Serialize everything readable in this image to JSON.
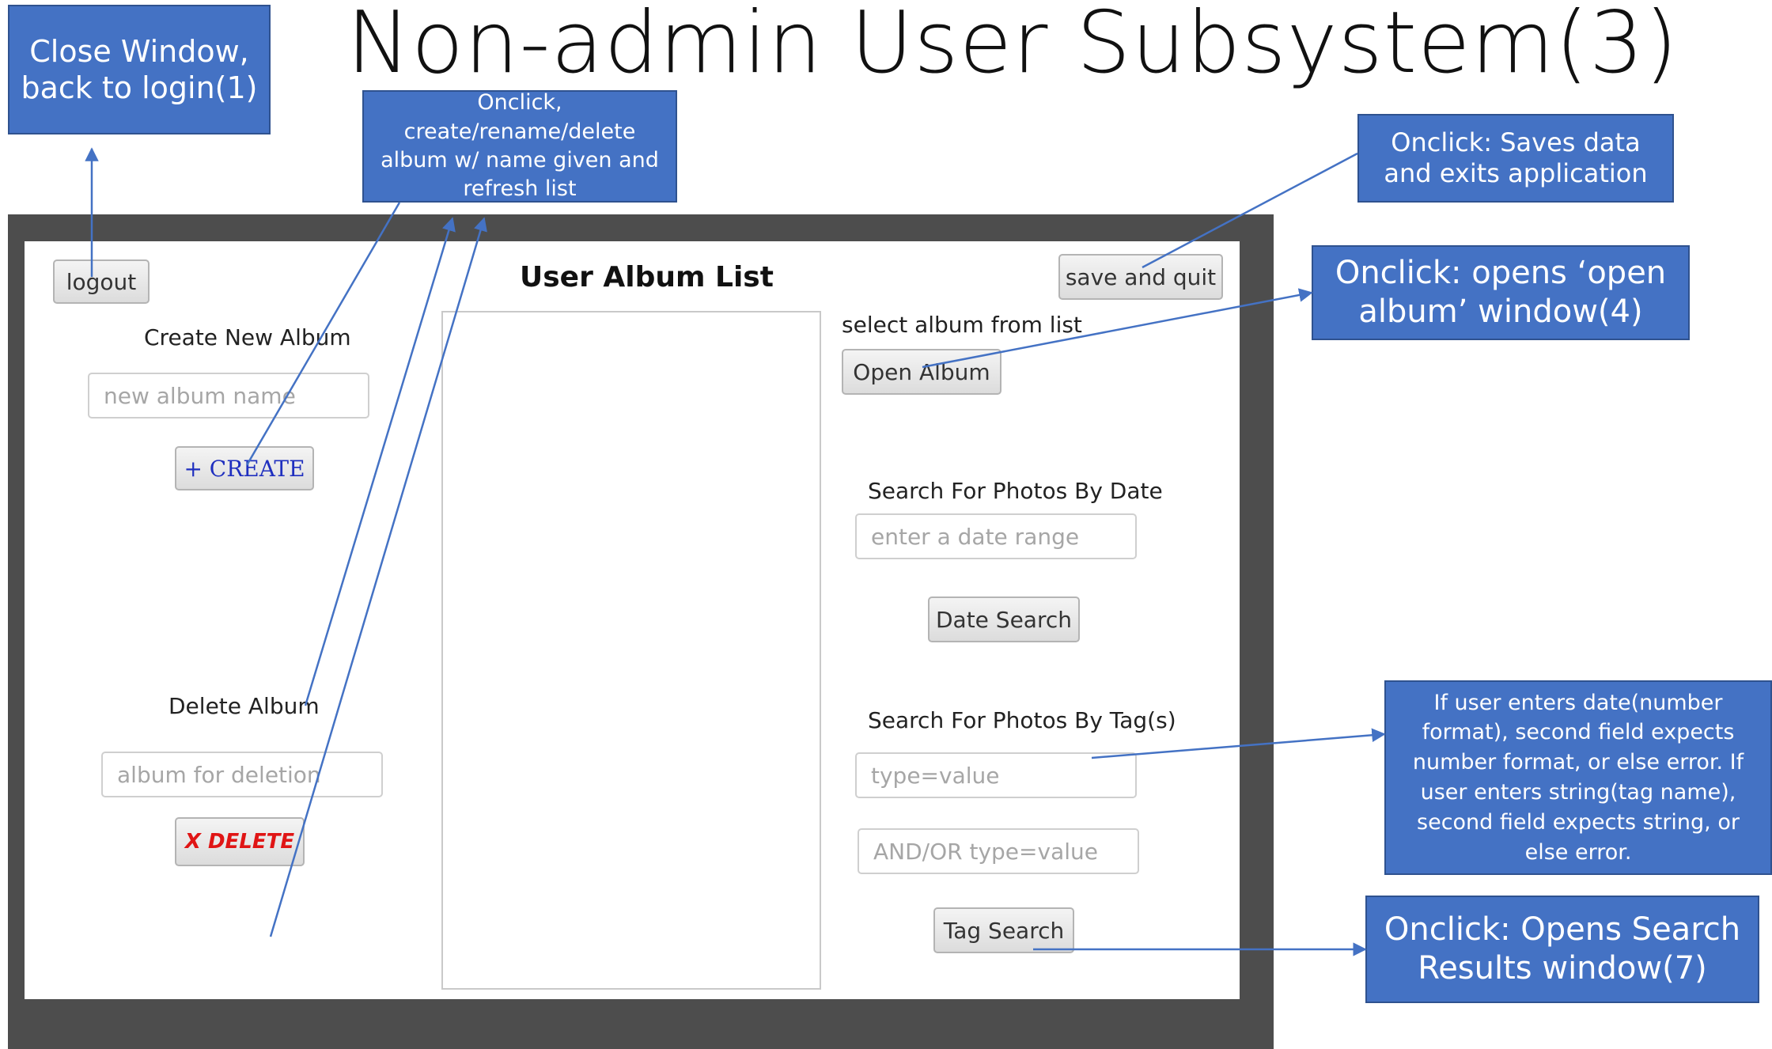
{
  "title": "Non-admin User Subsystem(3)",
  "callouts": {
    "close_window": "Close Window, back to login(1)",
    "album_ops": "Onclick, create/rename/delete album w/ name given and refresh list",
    "save_quit": "Onclick: Saves data and exits application",
    "open_album": "Onclick: opens ‘open album’ window(4)",
    "tag_rules": "If user enters date(number format), second field expects number format, or else error. If user enters string(tag name), second field expects string, or else error.",
    "search_results": "Onclick: Opens Search Results window(7)"
  },
  "app": {
    "logout_label": "logout",
    "create_section_label": "Create New Album",
    "new_album_placeholder": "new album name",
    "create_label": "+ CREATE",
    "delete_section_label": "Delete Album",
    "delete_placeholder": "album for deletion",
    "delete_label": "X DELETE",
    "list_title": "User Album List",
    "save_quit_label": "save and quit",
    "select_hint": "select album from list",
    "open_album_label": "Open Album",
    "date_search_section_label": "Search For Photos By Date",
    "date_range_placeholder": "enter a date range",
    "date_search_label": "Date Search",
    "tag_search_section_label": "Search For Photos By Tag(s)",
    "tag_placeholder": "type=value",
    "tag2_placeholder": "AND/OR type=value",
    "tag_search_label": "Tag Search"
  },
  "colors": {
    "callout_fill": "#4472c4",
    "create_text": "#1f2fbf",
    "delete_text": "#e01515",
    "window_frame": "#4d4d4d"
  }
}
